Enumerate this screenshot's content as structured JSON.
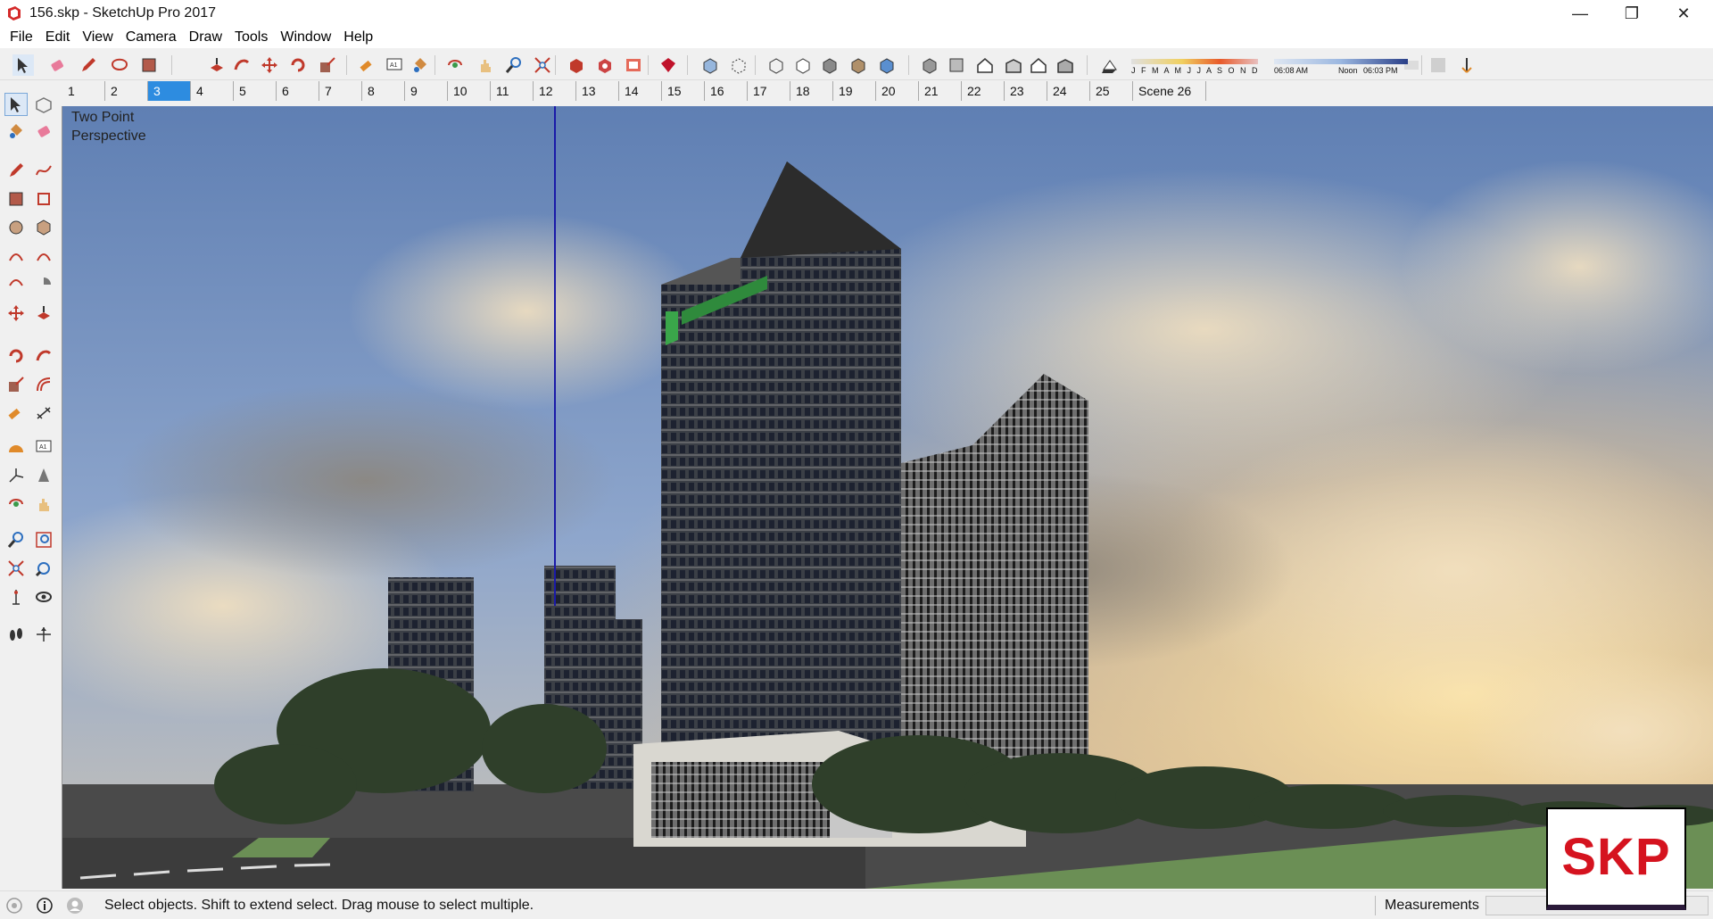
{
  "window": {
    "title": "156.skp - SketchUp Pro 2017",
    "controls": {
      "minimize": "—",
      "maximize": "❐",
      "close": "✕"
    }
  },
  "menu": [
    "File",
    "Edit",
    "View",
    "Camera",
    "Draw",
    "Tools",
    "Window",
    "Help"
  ],
  "toolbar": {
    "icons": [
      "select-icon",
      "eraser-icon",
      "pencil-icon",
      "shape-icon",
      "rectangle-icon",
      "push-pull-icon",
      "follow-me-icon",
      "move-icon",
      "rotate-icon",
      "scale-icon",
      "tape-measure-icon",
      "text-icon",
      "paint-bucket-icon",
      "orbit-icon",
      "pan-icon",
      "zoom-icon",
      "zoom-extents-icon",
      "warehouse-icon",
      "extension-warehouse-icon",
      "layout-icon",
      "ruby-icon",
      "xray-icon",
      "back-edges-icon",
      "wireframe-icon",
      "hidden-line-icon",
      "shaded-icon",
      "shaded-textures-icon",
      "monochrome-icon",
      "iso-view-icon",
      "top-view-icon",
      "front-view-icon",
      "right-view-icon",
      "back-view-icon",
      "left-view-icon",
      "shadows-icon",
      "fog-icon",
      "section-icon",
      "geolocation-icon"
    ],
    "shadow_months": "J F M A M J J A S O N D",
    "shadow_time_start": "06:08 AM",
    "shadow_time_mid": "Noon",
    "shadow_time_end": "06:03 PM",
    "shadow_colors": {
      "month_bar": "#e8a040",
      "time_bar_left": "#9bb7e0",
      "time_bar_right": "#2a3f88"
    }
  },
  "scenes": {
    "tabs": [
      "1",
      "2",
      "3",
      "4",
      "5",
      "6",
      "7",
      "8",
      "9",
      "10",
      "11",
      "12",
      "13",
      "14",
      "15",
      "16",
      "17",
      "18",
      "19",
      "20",
      "21",
      "22",
      "23",
      "24",
      "25",
      "Scene 26"
    ],
    "active": "3",
    "active_color": "#2d8ce0"
  },
  "palette": {
    "icons": [
      "select-icon",
      "make-component-icon",
      "paint-bucket-icon",
      "eraser-icon",
      "line-icon",
      "freehand-icon",
      "rectangle-icon",
      "rotated-rectangle-icon",
      "circle-icon",
      "polygon-icon",
      "arc-icon",
      "two-point-arc-icon",
      "three-point-arc-icon",
      "pie-icon",
      "move-icon",
      "push-pull-icon",
      "rotate-icon",
      "follow-me-icon",
      "scale-icon",
      "offset-icon",
      "tape-measure-icon",
      "dimension-icon",
      "protractor-icon",
      "text-icon",
      "axes-icon",
      "3d-text-icon",
      "orbit-icon",
      "pan-icon",
      "zoom-icon",
      "zoom-window-icon",
      "zoom-extents-icon",
      "previous-view-icon",
      "position-camera-icon",
      "look-around-icon",
      "walk-icon",
      "section-plane-icon"
    ]
  },
  "viewport": {
    "camera_label_line1": "Two Point",
    "camera_label_line2": "Perspective",
    "axis_color": "#1a1aa8"
  },
  "status": {
    "text": "Select objects. Shift to extend select. Drag mouse to select multiple.",
    "measurements_label": "Measurements",
    "measurements_value": ""
  },
  "badge": {
    "text": "SKP",
    "color": "#d5131f"
  }
}
